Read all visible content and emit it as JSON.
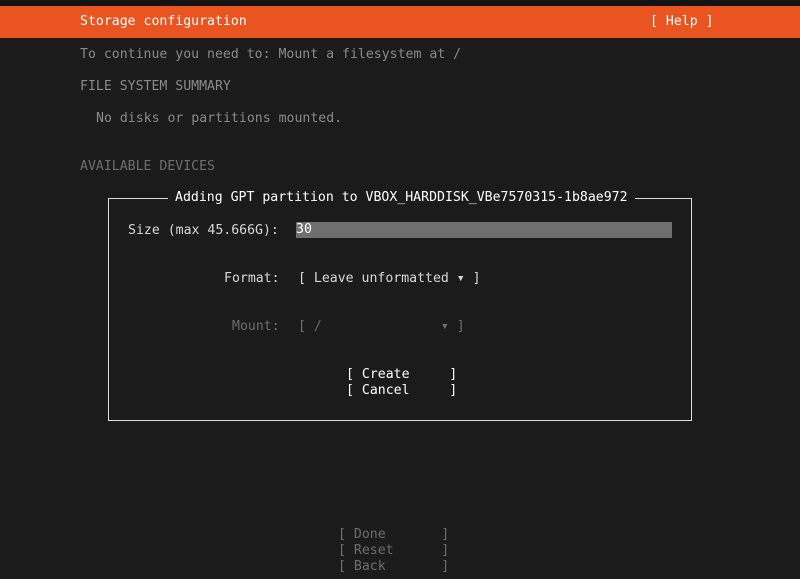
{
  "header": {
    "title": "Storage configuration",
    "help_button": "[ Help ]"
  },
  "instructions": "To continue you need to: Mount a filesystem at /",
  "summary": {
    "heading": "FILE SYSTEM SUMMARY",
    "empty_text": "No disks or partitions mounted."
  },
  "devices": {
    "heading": "AVAILABLE DEVICES"
  },
  "dialog": {
    "title": "Adding GPT partition to VBOX_HARDDISK_VBe7570315-1b8ae972",
    "size_label": "Size (max 45.666G):",
    "size_value": "30",
    "format_label": "Format:",
    "format_value": "[ Leave unformatted ▾ ]",
    "mount_label": "Mount:",
    "mount_value": "[ /               ▾ ]",
    "create_button": "[ Create     ]",
    "cancel_button": "[ Cancel     ]"
  },
  "footer": {
    "done_button": "[ Done       ]",
    "reset_button": "[ Reset      ]",
    "back_button": "[ Back       ]"
  },
  "colors": {
    "header_bg": "#e95420",
    "page_bg": "#1b1b1b",
    "field_bg": "#6f6f6f"
  }
}
